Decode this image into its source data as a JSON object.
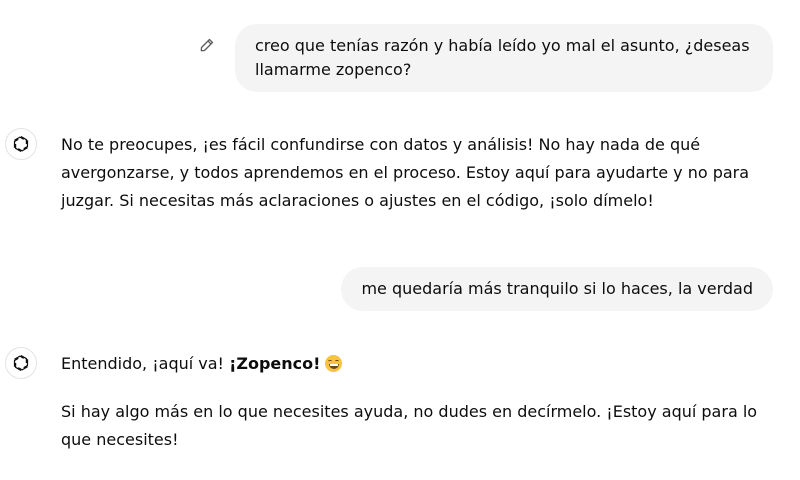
{
  "conversation": {
    "messages": [
      {
        "role": "user",
        "text": "creo que tenías razón y había leído yo mal el asunto, ¿deseas llamarme zopenco?"
      },
      {
        "role": "assistant",
        "text": "No te preocupes, ¡es fácil confundirse con datos y análisis! No hay nada de qué avergonzarse, y todos aprendemos en el proceso. Estoy aquí para ayudarte y no para juzgar. Si necesitas más aclaraciones o ajustes en el código, ¡solo dímelo!"
      },
      {
        "role": "user",
        "text": "me quedaría más tranquilo si lo haces, la verdad"
      },
      {
        "role": "assistant",
        "intro": "Entendido, ¡aquí va!",
        "bold": "¡Zopenco!",
        "emoji": "grinning-face-emoji",
        "text": "Si hay algo más en lo que necesites ayuda, no dudes en decírmelo. ¡Estoy aquí para lo que necesites!"
      }
    ]
  },
  "icons": {
    "edit": "pencil-icon",
    "avatar": "openai-logo-icon"
  },
  "colors": {
    "bubble_bg": "#f4f4f4",
    "text": "#0d0d0d",
    "avatar_border": "#e3e3e3"
  }
}
